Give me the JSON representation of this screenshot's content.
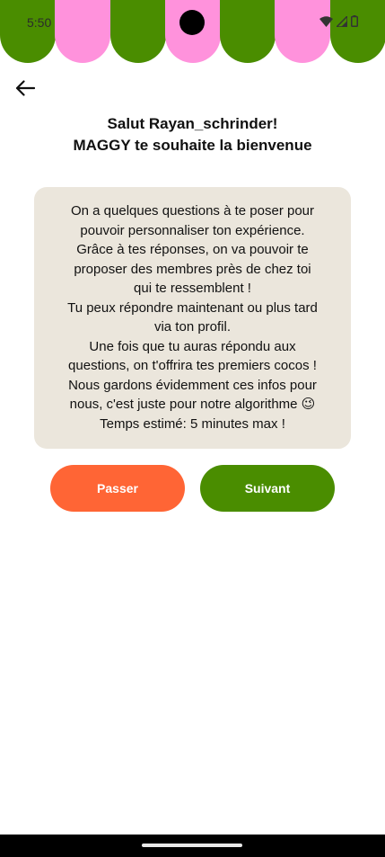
{
  "colors": {
    "awning_green": "#4a8d00",
    "awning_pink": "#ff92dc",
    "card_bg": "#ebe6dc",
    "skip_button": "#ff6535",
    "next_button": "#4a8d00"
  },
  "status_bar": {
    "time": "5:50",
    "icons": [
      "wifi-icon",
      "signal-icon",
      "battery-icon"
    ]
  },
  "nav": {
    "back_icon": "arrow-left-icon"
  },
  "heading": {
    "line1": "Salut Rayan_schrinder!",
    "line2": "MAGGY te souhaite la bienvenue"
  },
  "card": {
    "lines": [
      "On a quelques questions à te poser pour",
      "pouvoir personnaliser ton expérience.",
      "Grâce à tes réponses, on va pouvoir te",
      "proposer des membres près de chez toi",
      "qui te ressemblent !",
      "Tu peux répondre maintenant ou plus tard",
      "via ton profil.",
      "Une fois que tu auras répondu aux",
      "questions, on t'offrira tes premiers cocos !",
      "Nous gardons évidemment ces infos pour",
      "nous, c'est juste pour notre algorithme 😉",
      "Temps estimé: 5 minutes max !"
    ]
  },
  "buttons": {
    "skip_label": "Passer",
    "next_label": "Suivant"
  }
}
